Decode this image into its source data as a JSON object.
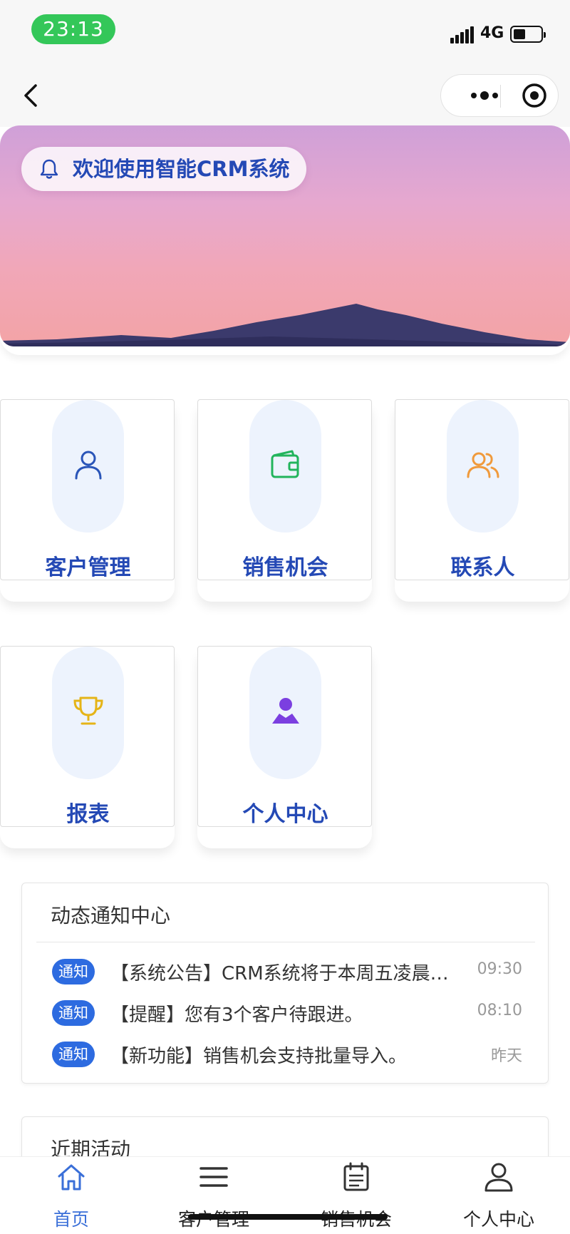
{
  "status_bar": {
    "time": "23:13",
    "network": "4G"
  },
  "hero": {
    "welcome_text": "欢迎使用智能CRM系统"
  },
  "modules": [
    {
      "label": "客户管理",
      "icon": "user-icon",
      "color": "#2a55b8"
    },
    {
      "label": "销售机会",
      "icon": "wallet-icon",
      "color": "#22b45c"
    },
    {
      "label": "联系人",
      "icon": "contacts-icon",
      "color": "#f09a3c"
    },
    {
      "label": "报表",
      "icon": "trophy-icon",
      "color": "#e5b417"
    },
    {
      "label": "个人中心",
      "icon": "person-icon",
      "color": "#7b3fe0"
    }
  ],
  "notifications": {
    "title": "动态通知中心",
    "items": [
      {
        "badge": "通知",
        "text": "【系统公告】CRM系统将于本周五凌晨…",
        "time": "09:30"
      },
      {
        "badge": "通知",
        "text": "【提醒】您有3个客户待跟进。",
        "time": "08:10"
      },
      {
        "badge": "通知",
        "text": "【新功能】销售机会支持批量导入。",
        "time": "昨天"
      }
    ]
  },
  "recent_activity": {
    "title": "近期活动"
  },
  "tabbar": {
    "items": [
      {
        "label": "首页",
        "icon": "home-icon",
        "active": true
      },
      {
        "label": "客户管理",
        "icon": "menu-icon",
        "active": false
      },
      {
        "label": "销售机会",
        "icon": "document-icon",
        "active": false
      },
      {
        "label": "个人中心",
        "icon": "user-icon",
        "active": false
      }
    ]
  },
  "colors": {
    "accent": "#2449b5",
    "active_tab": "#3a6fd8",
    "badge": "#2d6be0",
    "status_green": "#34c759"
  }
}
